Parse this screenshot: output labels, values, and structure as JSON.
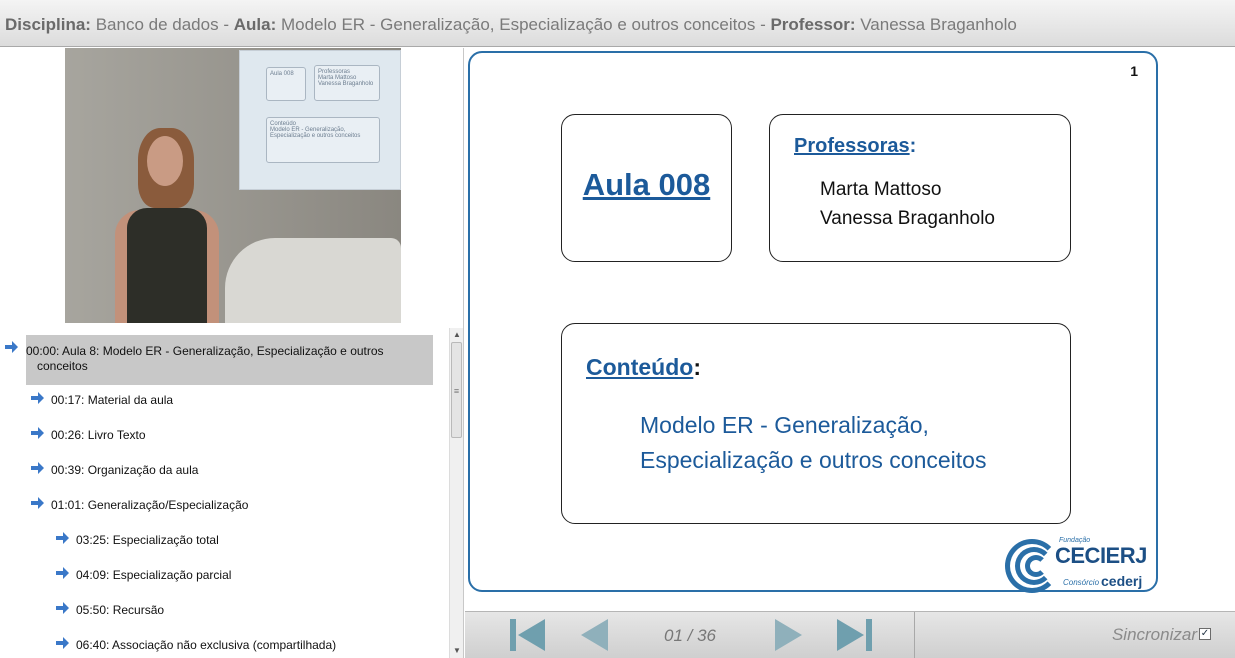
{
  "header": {
    "disciplina_label": "Disciplina:",
    "disciplina_value": "Banco de dados",
    "aula_label": "Aula:",
    "aula_value": "Modelo ER - Generalização, Especialização e outros conceitos",
    "professor_label": "Professor:",
    "professor_value": "Vanessa Braganholo",
    "separator": "-"
  },
  "video": {
    "screen_aula": "Aula 008",
    "screen_professoras": "Professoras",
    "screen_names": "Marta Mattoso Vanessa Braganholo",
    "screen_conteudo": "Conteúdo",
    "screen_conteudo_text": "Modelo ER - Generalização, Especialização e outros conceitos"
  },
  "toc": {
    "items": [
      {
        "label": "00:00: Aula 8: Modelo ER - Generalização, Especialização e outros",
        "label2": "conceitos",
        "level": 0,
        "selected": true
      },
      {
        "label": "00:17: Material da aula",
        "level": 1
      },
      {
        "label": "00:26: Livro Texto",
        "level": 1
      },
      {
        "label": "00:39: Organização da aula",
        "level": 1
      },
      {
        "label": "01:01: Generalização/Especialização",
        "level": 1
      },
      {
        "label": "03:25: Especialização total",
        "level": 2
      },
      {
        "label": "04:09: Especialização parcial",
        "level": 2
      },
      {
        "label": "05:50: Recursão",
        "level": 2
      },
      {
        "label": "06:40: Associação não exclusiva (compartilhada)",
        "level": 2
      }
    ]
  },
  "slide": {
    "number": "1",
    "aula_title": "Aula 008",
    "professoras_label": "Professoras",
    "colon": ":",
    "professoras": [
      "Marta Mattoso",
      "Vanessa Braganholo"
    ],
    "conteudo_label": "Conteúdo",
    "conteudo_lines": [
      "Modelo ER - Generalização,",
      "Especialização e outros conceitos"
    ],
    "logo": {
      "fundacao": "Fundação",
      "cecierj": "CECIERJ",
      "consorcio": "Consórcio",
      "cederj": "cederj"
    }
  },
  "nav": {
    "page_indicator": "01 / 36",
    "sync_label": "Sincronizar",
    "sync_checked": true
  },
  "colors": {
    "accent": "#1c5a9a",
    "nav_arrow": "#6f9fae",
    "selected_bg": "#c8c8c8"
  }
}
